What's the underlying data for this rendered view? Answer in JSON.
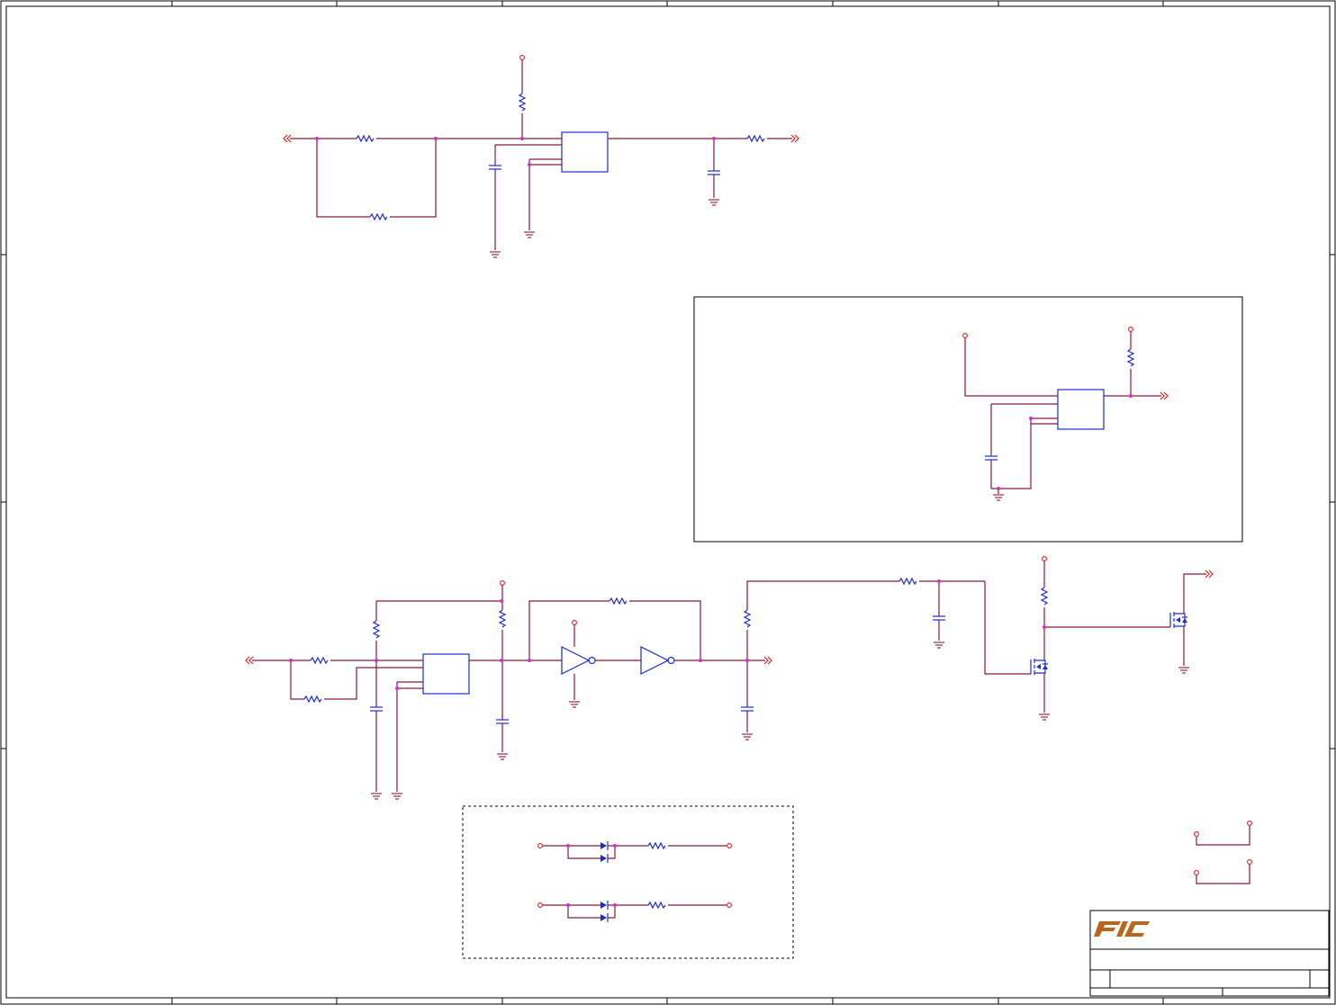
{
  "colors": {
    "wire": "#8b1a3a",
    "component": "#1f2ccf",
    "node_dot": "#cc33cc",
    "port": "#dd2222",
    "frame": "#000000",
    "logo": "#b8651d"
  },
  "icons": {
    "logo": "fic-logo"
  },
  "logo": {
    "text": "FIC"
  }
}
